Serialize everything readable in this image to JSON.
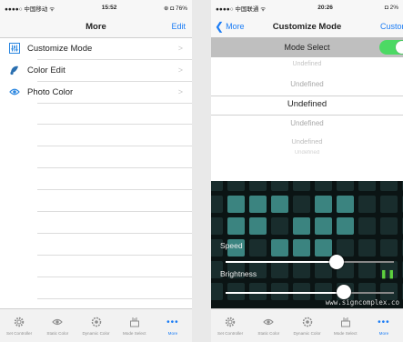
{
  "left_screen": {
    "status": {
      "carrier": "●●●●○ 中国移动 ᯤ",
      "time": "15:52",
      "right": "⊕ ◘ 76%"
    },
    "nav": {
      "title": "More",
      "edit": "Edit"
    },
    "menu": [
      {
        "label": "Customize Mode",
        "icon": "equalizer-icon"
      },
      {
        "label": "Color Edit",
        "icon": "color-drop-icon"
      },
      {
        "label": "Photo Color",
        "icon": "eye-icon"
      }
    ]
  },
  "right_screen": {
    "status": {
      "carrier": "●●●●○ 中国联通 ᯤ",
      "time": "20:26",
      "right": "◘ 2%"
    },
    "nav": {
      "back": "More",
      "title": "Customize Mode",
      "right": "Custom"
    },
    "mode_select": {
      "label": "Mode Select",
      "enabled": true
    },
    "picker": [
      "Undefined",
      "Undefined",
      "Undefined",
      "Undefined",
      "Undefined",
      "Undefined"
    ],
    "sliders": {
      "speed": {
        "label": "Speed",
        "value": 0.66
      },
      "brightness": {
        "label": "Brightness",
        "value": 0.7
      }
    },
    "watermark": "www.signcomplex.co"
  },
  "tabs": [
    {
      "label": "Set Controller",
      "icon": "gear-icon"
    },
    {
      "label": "Static Color",
      "icon": "eye-icon"
    },
    {
      "label": "Dynamic Color",
      "icon": "swirl-icon"
    },
    {
      "label": "Mode Select",
      "icon": "mode-icon"
    },
    {
      "label": "More",
      "icon": "more-dots-icon"
    }
  ],
  "colors": {
    "accent": "#1a7cf5",
    "toggle_on": "#4cd964",
    "active_led": "#3e8a86"
  }
}
